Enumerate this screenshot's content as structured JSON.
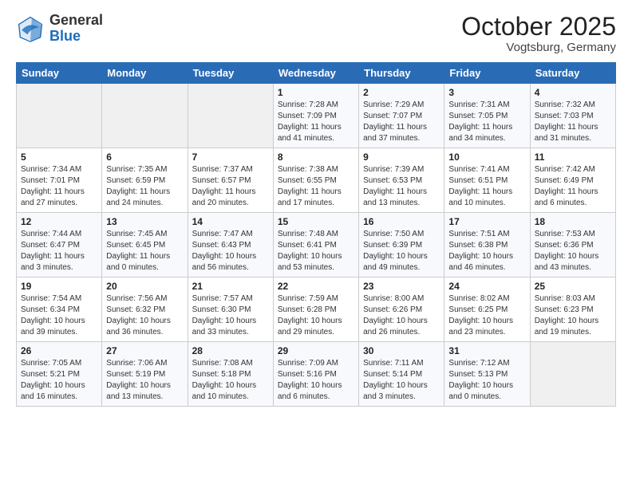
{
  "header": {
    "logo_general": "General",
    "logo_blue": "Blue",
    "month": "October 2025",
    "location": "Vogtsburg, Germany"
  },
  "weekdays": [
    "Sunday",
    "Monday",
    "Tuesday",
    "Wednesday",
    "Thursday",
    "Friday",
    "Saturday"
  ],
  "weeks": [
    [
      {
        "day": "",
        "info": ""
      },
      {
        "day": "",
        "info": ""
      },
      {
        "day": "",
        "info": ""
      },
      {
        "day": "1",
        "info": "Sunrise: 7:28 AM\nSunset: 7:09 PM\nDaylight: 11 hours\nand 41 minutes."
      },
      {
        "day": "2",
        "info": "Sunrise: 7:29 AM\nSunset: 7:07 PM\nDaylight: 11 hours\nand 37 minutes."
      },
      {
        "day": "3",
        "info": "Sunrise: 7:31 AM\nSunset: 7:05 PM\nDaylight: 11 hours\nand 34 minutes."
      },
      {
        "day": "4",
        "info": "Sunrise: 7:32 AM\nSunset: 7:03 PM\nDaylight: 11 hours\nand 31 minutes."
      }
    ],
    [
      {
        "day": "5",
        "info": "Sunrise: 7:34 AM\nSunset: 7:01 PM\nDaylight: 11 hours\nand 27 minutes."
      },
      {
        "day": "6",
        "info": "Sunrise: 7:35 AM\nSunset: 6:59 PM\nDaylight: 11 hours\nand 24 minutes."
      },
      {
        "day": "7",
        "info": "Sunrise: 7:37 AM\nSunset: 6:57 PM\nDaylight: 11 hours\nand 20 minutes."
      },
      {
        "day": "8",
        "info": "Sunrise: 7:38 AM\nSunset: 6:55 PM\nDaylight: 11 hours\nand 17 minutes."
      },
      {
        "day": "9",
        "info": "Sunrise: 7:39 AM\nSunset: 6:53 PM\nDaylight: 11 hours\nand 13 minutes."
      },
      {
        "day": "10",
        "info": "Sunrise: 7:41 AM\nSunset: 6:51 PM\nDaylight: 11 hours\nand 10 minutes."
      },
      {
        "day": "11",
        "info": "Sunrise: 7:42 AM\nSunset: 6:49 PM\nDaylight: 11 hours\nand 6 minutes."
      }
    ],
    [
      {
        "day": "12",
        "info": "Sunrise: 7:44 AM\nSunset: 6:47 PM\nDaylight: 11 hours\nand 3 minutes."
      },
      {
        "day": "13",
        "info": "Sunrise: 7:45 AM\nSunset: 6:45 PM\nDaylight: 11 hours\nand 0 minutes."
      },
      {
        "day": "14",
        "info": "Sunrise: 7:47 AM\nSunset: 6:43 PM\nDaylight: 10 hours\nand 56 minutes."
      },
      {
        "day": "15",
        "info": "Sunrise: 7:48 AM\nSunset: 6:41 PM\nDaylight: 10 hours\nand 53 minutes."
      },
      {
        "day": "16",
        "info": "Sunrise: 7:50 AM\nSunset: 6:39 PM\nDaylight: 10 hours\nand 49 minutes."
      },
      {
        "day": "17",
        "info": "Sunrise: 7:51 AM\nSunset: 6:38 PM\nDaylight: 10 hours\nand 46 minutes."
      },
      {
        "day": "18",
        "info": "Sunrise: 7:53 AM\nSunset: 6:36 PM\nDaylight: 10 hours\nand 43 minutes."
      }
    ],
    [
      {
        "day": "19",
        "info": "Sunrise: 7:54 AM\nSunset: 6:34 PM\nDaylight: 10 hours\nand 39 minutes."
      },
      {
        "day": "20",
        "info": "Sunrise: 7:56 AM\nSunset: 6:32 PM\nDaylight: 10 hours\nand 36 minutes."
      },
      {
        "day": "21",
        "info": "Sunrise: 7:57 AM\nSunset: 6:30 PM\nDaylight: 10 hours\nand 33 minutes."
      },
      {
        "day": "22",
        "info": "Sunrise: 7:59 AM\nSunset: 6:28 PM\nDaylight: 10 hours\nand 29 minutes."
      },
      {
        "day": "23",
        "info": "Sunrise: 8:00 AM\nSunset: 6:26 PM\nDaylight: 10 hours\nand 26 minutes."
      },
      {
        "day": "24",
        "info": "Sunrise: 8:02 AM\nSunset: 6:25 PM\nDaylight: 10 hours\nand 23 minutes."
      },
      {
        "day": "25",
        "info": "Sunrise: 8:03 AM\nSunset: 6:23 PM\nDaylight: 10 hours\nand 19 minutes."
      }
    ],
    [
      {
        "day": "26",
        "info": "Sunrise: 7:05 AM\nSunset: 5:21 PM\nDaylight: 10 hours\nand 16 minutes."
      },
      {
        "day": "27",
        "info": "Sunrise: 7:06 AM\nSunset: 5:19 PM\nDaylight: 10 hours\nand 13 minutes."
      },
      {
        "day": "28",
        "info": "Sunrise: 7:08 AM\nSunset: 5:18 PM\nDaylight: 10 hours\nand 10 minutes."
      },
      {
        "day": "29",
        "info": "Sunrise: 7:09 AM\nSunset: 5:16 PM\nDaylight: 10 hours\nand 6 minutes."
      },
      {
        "day": "30",
        "info": "Sunrise: 7:11 AM\nSunset: 5:14 PM\nDaylight: 10 hours\nand 3 minutes."
      },
      {
        "day": "31",
        "info": "Sunrise: 7:12 AM\nSunset: 5:13 PM\nDaylight: 10 hours\nand 0 minutes."
      },
      {
        "day": "",
        "info": ""
      }
    ]
  ]
}
